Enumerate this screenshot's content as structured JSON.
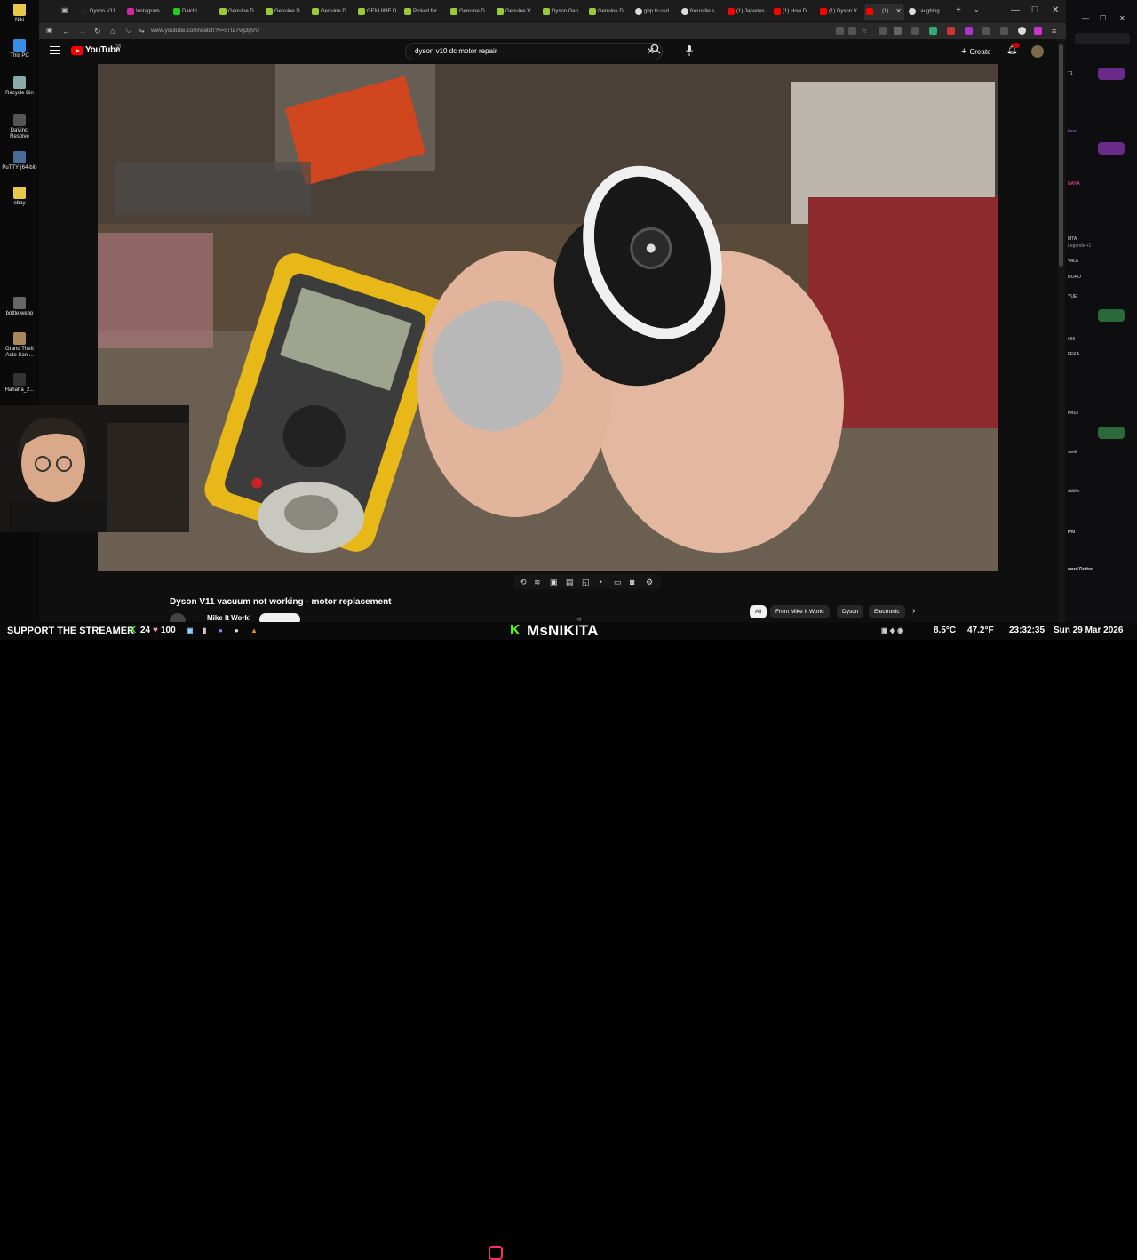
{
  "desktop": {
    "icons": [
      {
        "label": "Niki"
      },
      {
        "label": "This PC"
      },
      {
        "label": "Recycle Bin"
      },
      {
        "label": "DaVinci Resolve"
      },
      {
        "label": "PuTTY (64-bit)"
      },
      {
        "label": "ebay"
      },
      {
        "label": "bottle.webp"
      },
      {
        "label": "Grand Theft Auto San ..."
      },
      {
        "label": "Hahaha_2..."
      }
    ]
  },
  "browser": {
    "tabs": [
      {
        "label": "Dyson V11"
      },
      {
        "label": "Instagram"
      },
      {
        "label": "Daichi"
      },
      {
        "label": "Genuine D"
      },
      {
        "label": "Genuine D"
      },
      {
        "label": "Genuine D"
      },
      {
        "label": "GENUINE D"
      },
      {
        "label": "Picked for"
      },
      {
        "label": "Genuine D"
      },
      {
        "label": "Genuine V"
      },
      {
        "label": "Dyson Gen"
      },
      {
        "label": "Genuine D"
      },
      {
        "label": "gbp to usd"
      },
      {
        "label": "focusrite s"
      },
      {
        "label": "(1) Japanes"
      },
      {
        "label": "(1) How D"
      },
      {
        "label": "(1) Dyson V"
      },
      {
        "label": "(1)"
      },
      {
        "label": "Laughing"
      }
    ],
    "url": "www.youtube.com/watch?v=5Tta7vg3gVU"
  },
  "youtube": {
    "logo_text": "YouTube",
    "country_code": "GB",
    "search_value": "dyson v10  dc motor repair",
    "create_label": "Create",
    "video_title": "Dyson V11 vacuum not working - motor replacement",
    "channel_name": "Mike It Work!",
    "chips": [
      {
        "label": "All"
      },
      {
        "label": "From Mike It Work!"
      },
      {
        "label": "Dyson"
      },
      {
        "label": "Electronic"
      }
    ]
  },
  "chat": {
    "lines": [
      {
        "text": "T1"
      },
      {
        "text": "haac"
      },
      {
        "text": "NANA"
      },
      {
        "text": "MTA"
      },
      {
        "text": "Legends +1"
      },
      {
        "text": "VALE"
      },
      {
        "text": "DORO"
      },
      {
        "text": "YUE"
      },
      {
        "text": "666"
      },
      {
        "text": "FEKA"
      },
      {
        "text": "PAST"
      },
      {
        "text": "seek"
      },
      {
        "text": "obbler"
      },
      {
        "text": "Pr0"
      },
      {
        "text": "ward Dutton"
      }
    ]
  },
  "taskbar": {
    "support_text": "SUPPORT THE STREAMER",
    "sub_count": "24",
    "sub_goal": "100",
    "kick_logo": "K",
    "streamer_name": "MsNIKITA",
    "weather": "8.5°C",
    "temp2": "47.2°F",
    "time": "23:32:35",
    "date": "Sun 29 Mar 2026"
  },
  "colors": {
    "youtube_red": "#ff0000",
    "kick_green": "#53fc18",
    "chat_bg": "#0e0e10"
  }
}
